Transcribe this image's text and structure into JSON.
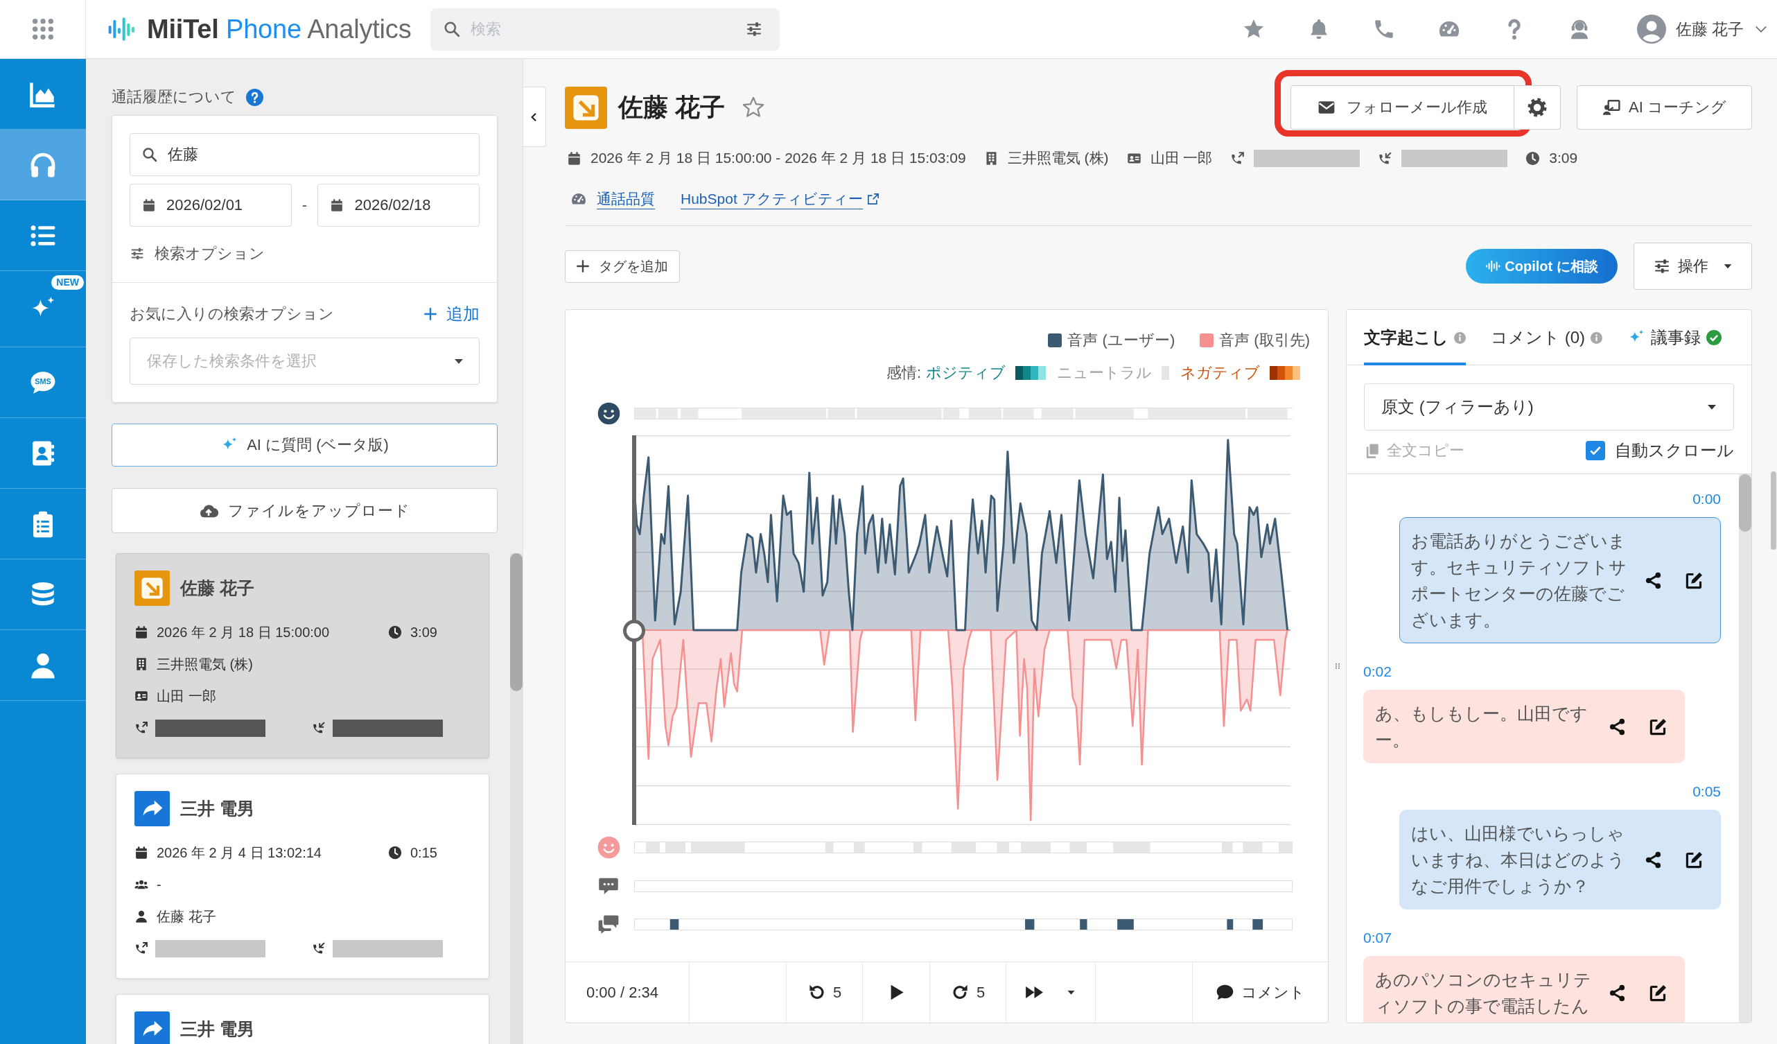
{
  "app_bar": {
    "logo": {
      "brand": "MiiTel",
      "product": "Phone",
      "suffix": "Analytics"
    },
    "search": {
      "placeholder": "検索"
    },
    "user": {
      "name": "佐藤 花子"
    }
  },
  "nav": [
    {
      "selected": false
    },
    {
      "selected": true
    },
    {
      "selected": false
    },
    {
      "selected": false,
      "badge": "NEW"
    },
    {
      "selected": false,
      "glyph": "SMS"
    },
    {
      "selected": false
    },
    {
      "selected": false
    },
    {
      "selected": false
    },
    {
      "selected": false
    }
  ],
  "history": {
    "title": "通話履歴について",
    "search": {
      "value": "佐藤"
    },
    "date_from": "2026/02/01",
    "date_separator": "-",
    "date_to": "2026/02/18",
    "search_options": "検索オプション",
    "saved_search": {
      "label": "お気に入りの検索オプション",
      "add": "追加",
      "placeholder": "保存した検索条件を選択"
    },
    "ask_ai": "AI に質問 (ベータ版)",
    "upload": "ファイルをアップロード",
    "calls": [
      {
        "kind": "incoming",
        "selected": true,
        "name": "佐藤 花子",
        "date": "2026 年 2 月 18 日 15:00:00",
        "duration": "3:09",
        "details": [
          {
            "kind": "company",
            "text": "三井照電気 (株)"
          },
          {
            "kind": "contact",
            "text": "山田 一郎"
          }
        ]
      },
      {
        "kind": "forwarded",
        "selected": false,
        "name": "三井 電男",
        "date": "2026 年 2 月 4 日 13:02:14",
        "duration": "0:15",
        "details": [
          {
            "kind": "participants",
            "text": "-"
          },
          {
            "kind": "user",
            "text": "佐藤 花子"
          }
        ]
      },
      {
        "kind": "forwarded",
        "selected": false,
        "name": "三井 電男"
      }
    ]
  },
  "call": {
    "kind": "incoming",
    "name": "佐藤 花子",
    "starred": false,
    "actions": [
      {
        "kind": "mail",
        "label": "フォローメール作成",
        "highlighted": true
      },
      {
        "kind": "settings",
        "highlighted": false
      },
      {
        "kind": "coaching",
        "label": "AI コーチング",
        "highlighted": false
      }
    ],
    "meta": [
      {
        "kind": "date",
        "text": "2026 年 2 月 18 日 15:00:00 - 2026 年 2 月 18 日 15:03:09"
      },
      {
        "kind": "company",
        "text": "三井照電気 (株)"
      },
      {
        "kind": "contact",
        "text": "山田 一郎"
      },
      {
        "kind": "outgoing"
      },
      {
        "kind": "incoming"
      },
      {
        "kind": "duration",
        "text": "3:09"
      }
    ],
    "links": [
      {
        "kind": "quality",
        "label": "通話品質"
      },
      {
        "kind": "external",
        "label": "HubSpot アクティビティー"
      }
    ],
    "add_tag": "タグを追加",
    "copilot": "Copilot に相談",
    "operations": "操作"
  },
  "voice_chart": {
    "legend": [
      {
        "label": "音声 (ユーザー)",
        "color": "#3d5a73"
      },
      {
        "label": "音声 (取引先)",
        "color": "#f59090"
      }
    ],
    "sentiment": {
      "label": "感情:",
      "items": [
        {
          "kind": "positive",
          "label": "ポジティブ"
        },
        {
          "kind": "neutral",
          "label": "ニュートラル"
        },
        {
          "kind": "negative",
          "label": "ネガティブ"
        }
      ]
    }
  },
  "player": {
    "position": "0:00 / 2:34",
    "rewind": "5",
    "forward": "5",
    "comment": "コメント"
  },
  "transcript": {
    "tabs": [
      {
        "kind": "info",
        "label": "文字起こし",
        "selected": true
      },
      {
        "kind": "info",
        "label": "コメント (0)",
        "selected": false
      },
      {
        "kind": "ai",
        "label": "議事録",
        "selected": false
      }
    ],
    "view": "原文 (フィラーあり)",
    "copy_all": {
      "label": "全文コピー",
      "disabled": true
    },
    "auto_scroll": {
      "label": "自動スクロール",
      "checked": true
    },
    "messages": [
      {
        "time": "0:00",
        "kind": "user",
        "active": true,
        "text": "お電話ありがとうございます。セキュリティソフトサポートセンターの佐藤でございます。"
      },
      {
        "time": "0:02",
        "kind": "customer",
        "active": false,
        "text": "あ、もしもしー。山田ですー。"
      },
      {
        "time": "0:05",
        "kind": "user",
        "active": false,
        "text": "はい、山田様でいらっしゃいますね、本日はどのようなご用件でしょうか？"
      },
      {
        "time": "0:07",
        "kind": "customer",
        "active": false,
        "text": "あのパソコンのセキュリティソフトの事で電話したん"
      }
    ]
  }
}
